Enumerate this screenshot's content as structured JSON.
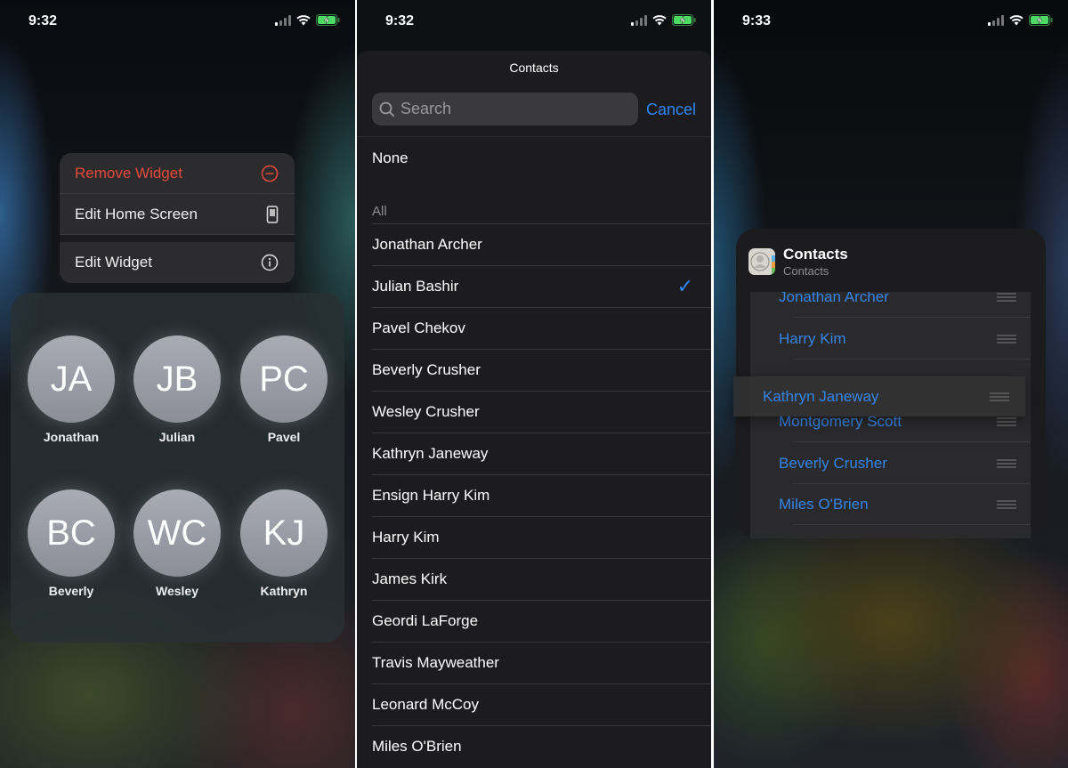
{
  "colors": {
    "accent": "#2f86f6",
    "destructive": "#e5493a"
  },
  "panel1": {
    "status": {
      "time": "9:32"
    },
    "menu": [
      {
        "label": "Remove Widget",
        "icon": "minus-circle-icon"
      },
      {
        "label": "Edit Home Screen",
        "icon": "phone-apps-icon"
      },
      {
        "label": "Edit Widget",
        "icon": "info-icon"
      }
    ],
    "contacts": [
      {
        "initials": "JA",
        "name": "Jonathan"
      },
      {
        "initials": "JB",
        "name": "Julian"
      },
      {
        "initials": "PC",
        "name": "Pavel"
      },
      {
        "initials": "BC",
        "name": "Beverly"
      },
      {
        "initials": "WC",
        "name": "Wesley"
      },
      {
        "initials": "KJ",
        "name": "Kathryn"
      }
    ]
  },
  "panel2": {
    "status": {
      "time": "9:32"
    },
    "title": "Contacts",
    "search_placeholder": "Search",
    "cancel": "Cancel",
    "none": "None",
    "section": "All",
    "selected": "Julian Bashir",
    "contacts": [
      "Jonathan Archer",
      "Julian Bashir",
      "Pavel Chekov",
      "Beverly Crusher",
      "Wesley Crusher",
      "Kathryn Janeway",
      "Ensign Harry Kim",
      "Harry Kim",
      "James Kirk",
      "Geordi LaForge",
      "Travis Mayweather",
      "Leonard McCoy",
      "Miles O'Brien"
    ]
  },
  "panel3": {
    "status": {
      "time": "9:33"
    },
    "widget_title": "Contacts",
    "widget_subtitle": "Contacts",
    "list": [
      "Jonathan Archer",
      "Harry Kim",
      "Montgomery Scott",
      "Beverly Crusher",
      "Miles O'Brien"
    ],
    "dragging": "Kathryn Janeway"
  }
}
